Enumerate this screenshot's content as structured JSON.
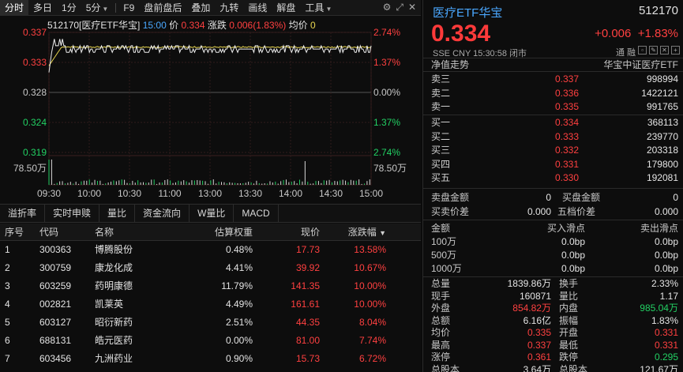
{
  "toolbar": {
    "tabs": [
      "分时",
      "多日",
      "1分",
      "5分"
    ],
    "items": [
      "F9",
      "盘前盘后",
      "叠加",
      "九转",
      "画线",
      "解盘",
      "工具"
    ]
  },
  "chart": {
    "header": {
      "code_name": "512170[医疗ETF华宝]",
      "time": "15:00",
      "price_label": "价",
      "price": "0.334",
      "change_label": "涨跌",
      "change": "0.006(1.83%)",
      "avg_label": "均价",
      "avg_value": "0"
    },
    "left_ticks": [
      "0.337",
      "0.333",
      "0.328",
      "0.324",
      "0.319"
    ],
    "right_ticks": [
      "2.74%",
      "1.37%",
      "0.00%",
      "1.37%",
      "2.74%"
    ],
    "volume_left": "78.50万",
    "volume_right": "78.50万",
    "time_ticks": [
      "09:30",
      "10:00",
      "10:30",
      "11:00",
      "13:00",
      "13:30",
      "14:00",
      "14:30",
      "15:00"
    ]
  },
  "subtabs": [
    "溢折率",
    "实时申赎",
    "量比",
    "资金流向",
    "W量比",
    "MACD"
  ],
  "table": {
    "headers": [
      "序号",
      "代码",
      "名称",
      "估算权重",
      "现价",
      "涨跌幅"
    ],
    "rows": [
      [
        "1",
        "300363",
        "博腾股份",
        "0.48%",
        "17.73",
        "13.58%"
      ],
      [
        "2",
        "300759",
        "康龙化成",
        "4.41%",
        "39.92",
        "10.67%"
      ],
      [
        "3",
        "603259",
        "药明康德",
        "11.79%",
        "141.35",
        "10.00%"
      ],
      [
        "4",
        "002821",
        "凯莱英",
        "4.49%",
        "161.61",
        "10.00%"
      ],
      [
        "5",
        "603127",
        "昭衍新药",
        "2.51%",
        "44.35",
        "8.04%"
      ],
      [
        "6",
        "688131",
        "皓元医药",
        "0.00%",
        "81.00",
        "7.74%"
      ],
      [
        "7",
        "603456",
        "九洲药业",
        "0.90%",
        "15.73",
        "6.72%"
      ]
    ]
  },
  "quote": {
    "title": "医疗ETF华宝",
    "code": "512170",
    "price": "0.334",
    "change": "+0.006",
    "change_pct": "+1.83%",
    "meta": "SSE  CNY  15:30:58  闭市",
    "flags": "通  融",
    "nav_label": "净值走势",
    "nav_index": "华宝中证医疗ETF"
  },
  "orderbook": {
    "asks": [
      [
        "卖三",
        "0.337",
        "998994"
      ],
      [
        "卖二",
        "0.336",
        "1422121"
      ],
      [
        "卖一",
        "0.335",
        "991765"
      ]
    ],
    "bids": [
      [
        "买一",
        "0.334",
        "368113"
      ],
      [
        "买二",
        "0.333",
        "239770"
      ],
      [
        "买三",
        "0.332",
        "203318"
      ],
      [
        "买四",
        "0.331",
        "179800"
      ],
      [
        "买五",
        "0.330",
        "192081"
      ]
    ]
  },
  "amounts": {
    "sell_amount_label": "卖盘金额",
    "sell_amount": "0",
    "buy_amount_label": "买盘金额",
    "buy_amount": "0",
    "spread_label": "买卖价差",
    "spread": "0.000",
    "five_spread_label": "五档价差",
    "five_spread": "0.000"
  },
  "slippage": {
    "headers": [
      "金额",
      "买入滑点",
      "卖出滑点"
    ],
    "rows": [
      [
        "100万",
        "0.0bp",
        "0.0bp"
      ],
      [
        "500万",
        "0.0bp",
        "0.0bp"
      ],
      [
        "1000万",
        "0.0bp",
        "0.0bp"
      ]
    ]
  },
  "stats": [
    [
      "总量",
      "1839.86万",
      "换手",
      "2.33%"
    ],
    [
      "现手",
      "160871",
      "量比",
      "1.17"
    ],
    [
      "外盘",
      "854.82万",
      "内盘",
      "985.04万"
    ],
    [
      "总额",
      "6.16亿",
      "振幅",
      "1.83%"
    ],
    [
      "均价",
      "0.335",
      "开盘",
      "0.331"
    ],
    [
      "最高",
      "0.337",
      "最低",
      "0.331"
    ],
    [
      "涨停",
      "0.361",
      "跌停",
      "0.295"
    ],
    [
      "总股本",
      "3.64万",
      "总股本",
      "121.67万"
    ]
  ],
  "colors": {
    "up": "#ff4040",
    "down": "#22d063",
    "accent": "#4aa8ff",
    "avg_line": "#e8d650"
  }
}
